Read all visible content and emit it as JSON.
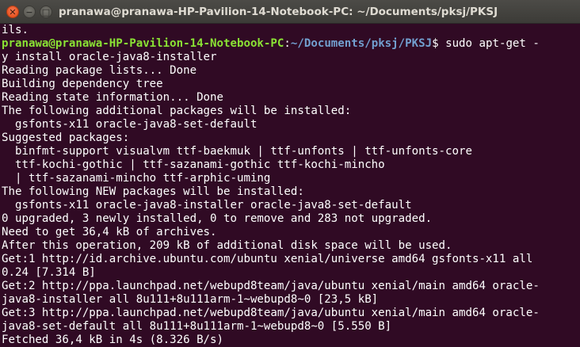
{
  "window": {
    "title": "pranawa@pranawa-HP-Pavilion-14-Notebook-PC: ~/Documents/pksj/PKSJ",
    "close_glyph": "✕",
    "minimize_glyph": "−",
    "maximize_glyph": "□"
  },
  "colors": {
    "background": "#300a24",
    "text": "#ffffff",
    "prompt_user": "#8ae234",
    "prompt_path": "#729fcf",
    "close_button": "#e95420"
  },
  "terminal": {
    "line0": "ils.",
    "prompt": {
      "user_host": "pranawa@pranawa-HP-Pavilion-14-Notebook-PC",
      "colon": ":",
      "path": "~/Documents/pksj/PKSJ",
      "dollar": "$",
      "command_start": " sudo apt-get -"
    },
    "lines": [
      "y install oracle-java8-installer",
      "Reading package lists... Done",
      "Building dependency tree",
      "Reading state information... Done",
      "The following additional packages will be installed:",
      "  gsfonts-x11 oracle-java8-set-default",
      "Suggested packages:",
      "  binfmt-support visualvm ttf-baekmuk | ttf-unfonts | ttf-unfonts-core",
      "  ttf-kochi-gothic | ttf-sazanami-gothic ttf-kochi-mincho",
      "  | ttf-sazanami-mincho ttf-arphic-uming",
      "The following NEW packages will be installed:",
      "  gsfonts-x11 oracle-java8-installer oracle-java8-set-default",
      "0 upgraded, 3 newly installed, 0 to remove and 283 not upgraded.",
      "Need to get 36,4 kB of archives.",
      "After this operation, 209 kB of additional disk space will be used.",
      "Get:1 http://id.archive.ubuntu.com/ubuntu xenial/universe amd64 gsfonts-x11 all",
      "0.24 [7.314 B]",
      "Get:2 http://ppa.launchpad.net/webupd8team/java/ubuntu xenial/main amd64 oracle-",
      "java8-installer all 8u111+8u111arm-1~webupd8~0 [23,5 kB]",
      "Get:3 http://ppa.launchpad.net/webupd8team/java/ubuntu xenial/main amd64 oracle-",
      "java8-set-default all 8u111+8u111arm-1~webupd8~0 [5.550 B]",
      "Fetched 36,4 kB in 4s (8.326 B/s)"
    ]
  }
}
